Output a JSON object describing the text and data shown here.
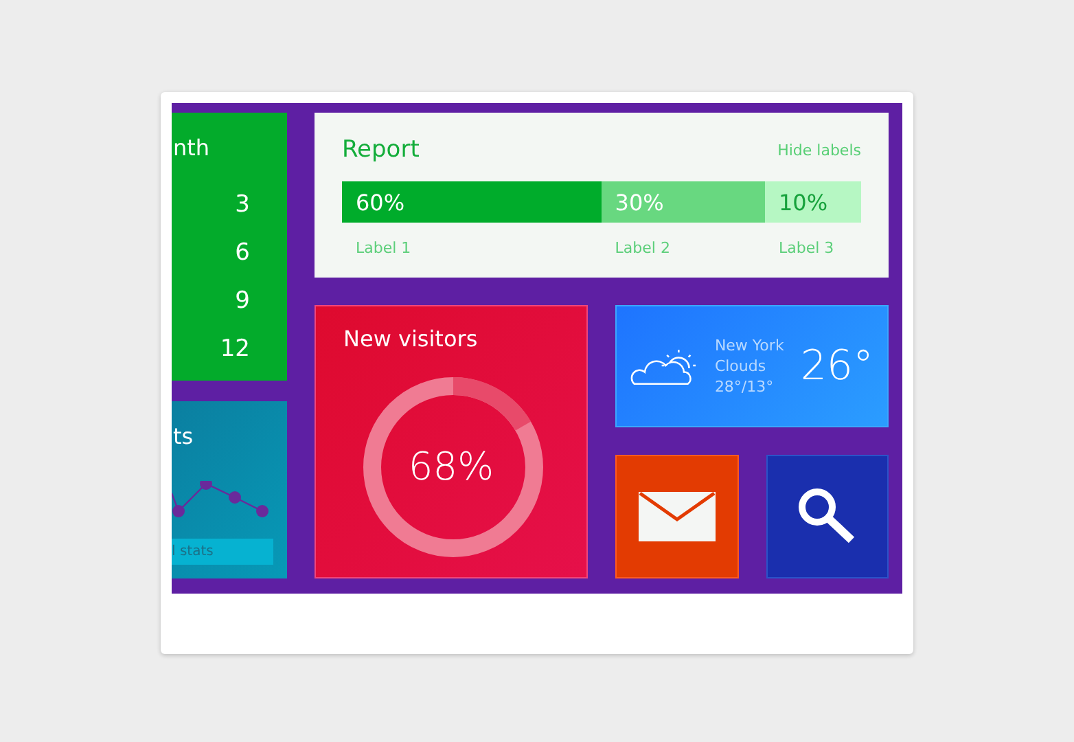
{
  "month_tile": {
    "title": "nth",
    "values": [
      "3",
      "6",
      "9",
      "12"
    ]
  },
  "stats_tile": {
    "title": "ts",
    "footer": "l stats"
  },
  "report": {
    "title": "Report",
    "toggle": "Hide labels",
    "segments": [
      {
        "value": "60%",
        "label": "Label 1"
      },
      {
        "value": "30%",
        "label": "Label 2"
      },
      {
        "value": "10%",
        "label": "Label 3"
      }
    ]
  },
  "visitors": {
    "title": "New visitors",
    "value": "68%"
  },
  "weather": {
    "city": "New York",
    "condition": "Clouds",
    "range": "28°/13°",
    "temperature": "26°"
  }
}
